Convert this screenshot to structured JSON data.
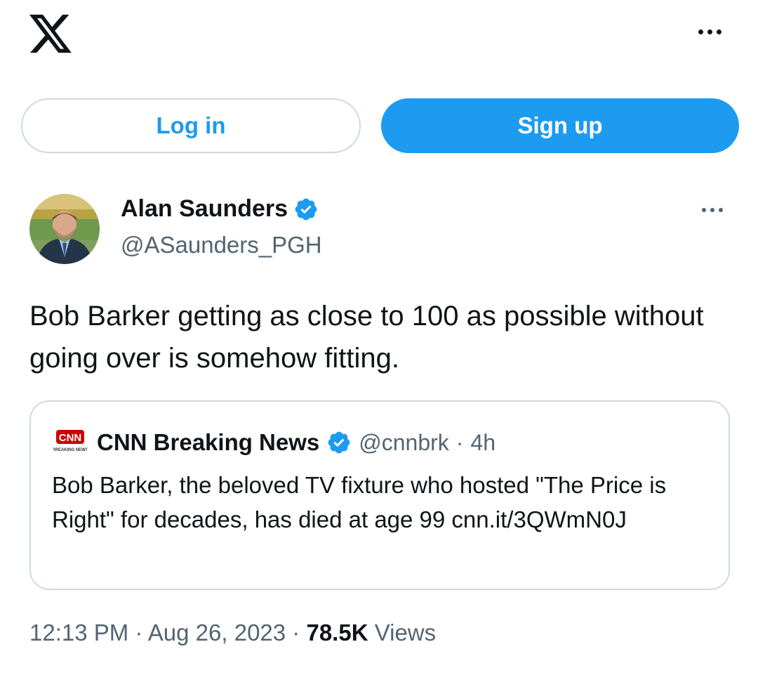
{
  "header": {
    "logo_icon": "x-logo-icon",
    "more_icon": "more-horizontal-icon"
  },
  "auth": {
    "login_label": "Log in",
    "signup_label": "Sign up"
  },
  "tweet": {
    "author_name": "Alan Saunders",
    "author_handle": "@ASaunders_PGH",
    "verified_icon": "verified-badge-icon",
    "text": "Bob Barker getting as close to 100 as possible without going over is somehow fitting.",
    "time": "12:13 PM",
    "separator": "·",
    "date": "Aug 26, 2023",
    "views_count": "78.5K",
    "views_label": "Views"
  },
  "quoted_tweet": {
    "author_name": "CNN Breaking News",
    "author_handle": "@cnnbrk",
    "separator": "·",
    "age": "4h",
    "text": "Bob Barker, the beloved TV fixture who hosted \"The Price is Right\" for decades, has died at age 99 cnn.it/3QWmN0J",
    "avatar_logo_text": "CNN",
    "avatar_sub_text": "BREAKING NEWS"
  },
  "colors": {
    "accent": "#1d9bf0",
    "text": "#0f1419",
    "muted": "#536471",
    "border": "#cfd9de",
    "cnn_red": "#cc0000"
  }
}
